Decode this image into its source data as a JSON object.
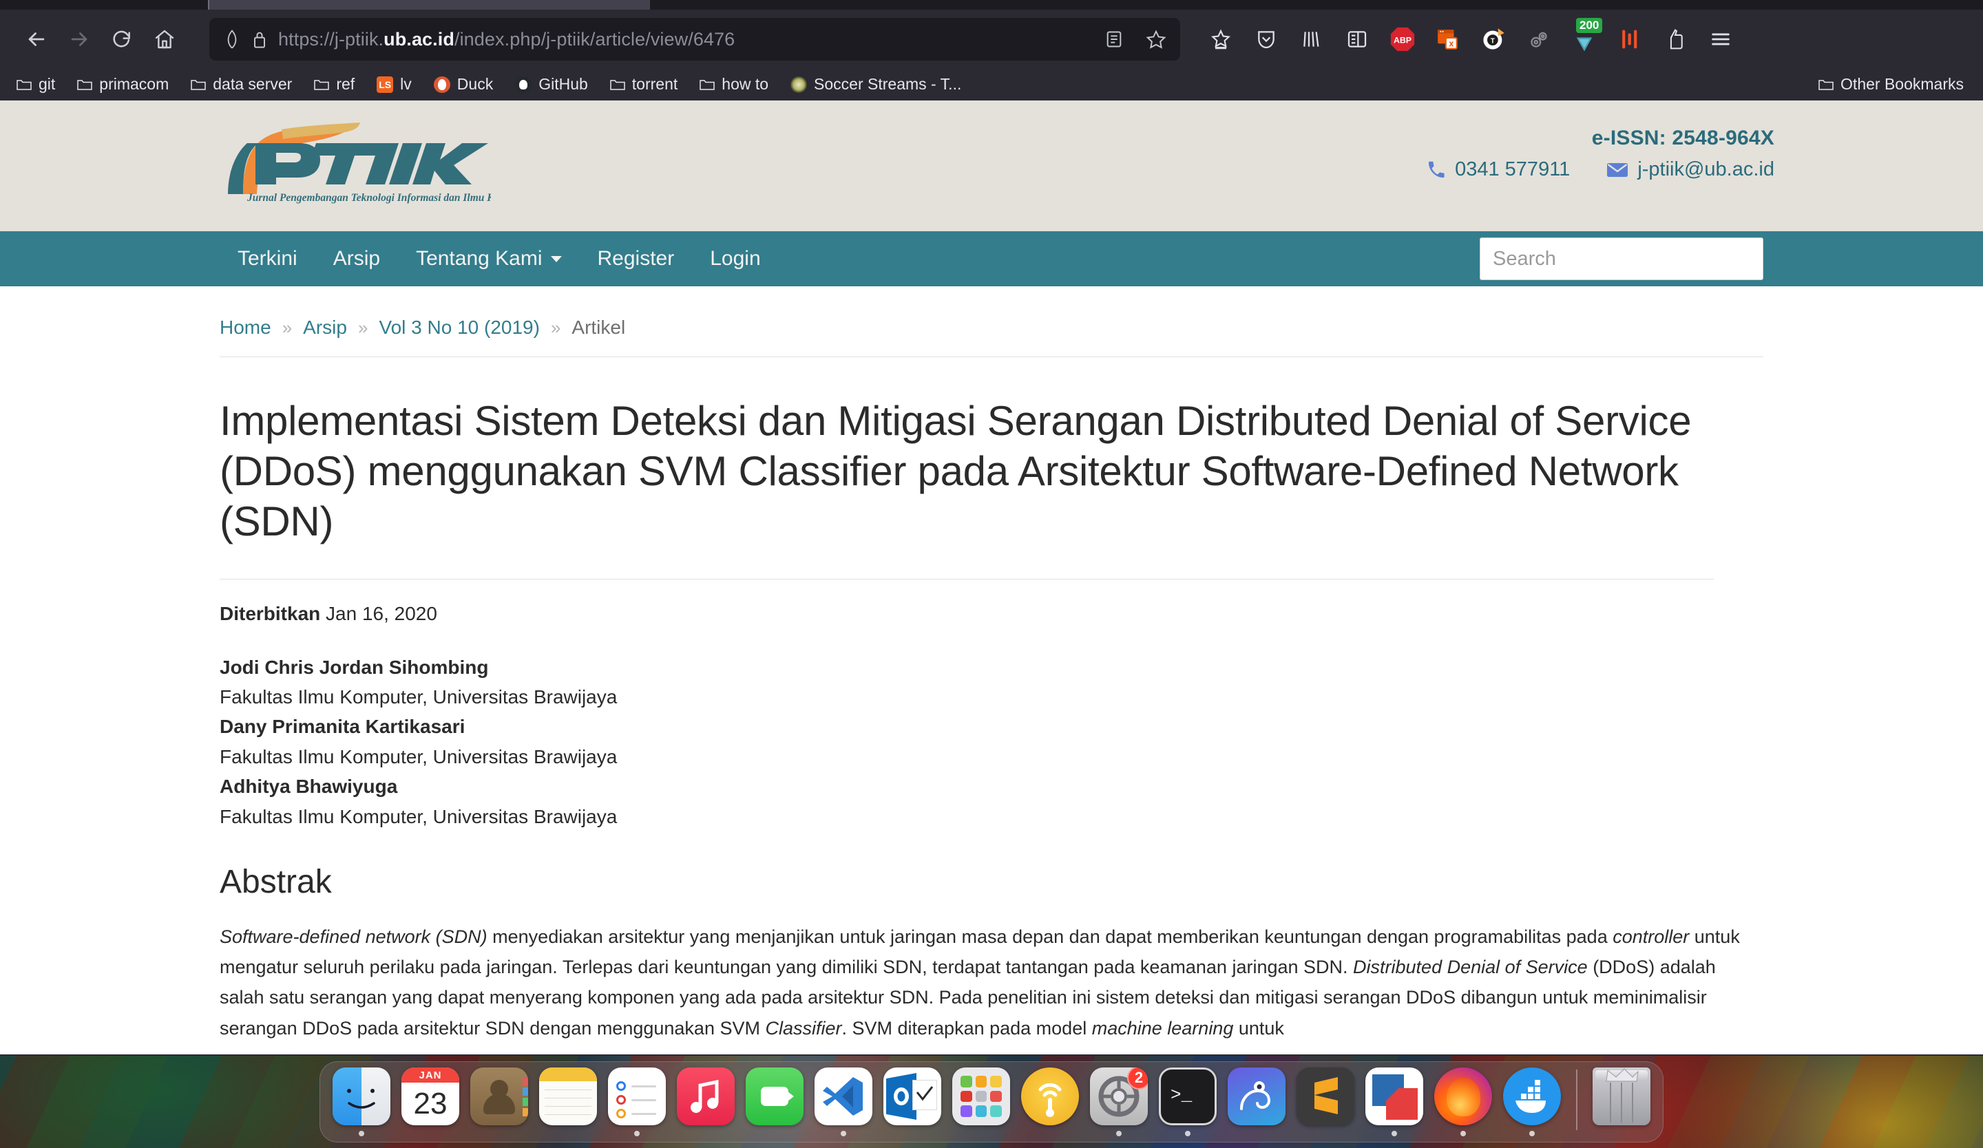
{
  "browser": {
    "url_prefix": "https://j-ptiik.",
    "url_domain": "ub.ac.id",
    "url_suffix": "/index.php/j-ptiik/article/view/6476",
    "toolbar_icons": [
      {
        "name": "back-button",
        "glyph": "←"
      },
      {
        "name": "forward-button",
        "glyph": "→"
      },
      {
        "name": "reload-button",
        "glyph": "⟳"
      },
      {
        "name": "home-button",
        "glyph": "⌂"
      }
    ],
    "extension_badge": "200",
    "extension_labels": [
      "bookmark-star",
      "pocket",
      "library",
      "reader-view",
      "adblock-plus",
      "popup-blocker",
      "tampermonkey",
      "cogs-extension",
      "umatrix",
      "redirector",
      "cookie-autodelete",
      "app-menu"
    ],
    "bookmarks": [
      {
        "label": "git",
        "icon": "folder-icon"
      },
      {
        "label": "primacom",
        "icon": "folder-icon"
      },
      {
        "label": "data server",
        "icon": "folder-icon"
      },
      {
        "label": "ref",
        "icon": "folder-icon"
      },
      {
        "label": "lv",
        "icon": "ls-favicon"
      },
      {
        "label": "Duck",
        "icon": "duckduckgo-favicon"
      },
      {
        "label": "GitHub",
        "icon": "github-favicon"
      },
      {
        "label": "torrent",
        "icon": "folder-icon"
      },
      {
        "label": "how to",
        "icon": "folder-icon"
      },
      {
        "label": "Soccer Streams - T...",
        "icon": "soccer-favicon"
      }
    ],
    "other_bookmarks": "Other Bookmarks"
  },
  "site": {
    "logo_text": "JPTIIK",
    "logo_tagline": "Jurnal Pengembangan Teknologi Informasi dan Ilmu Komputer",
    "eissn": "e-ISSN: 2548-964X",
    "phone": "0341 577911",
    "email": "j-ptiik@ub.ac.id",
    "nav": [
      {
        "label": "Terkini",
        "has_caret": false
      },
      {
        "label": "Arsip",
        "has_caret": false
      },
      {
        "label": "Tentang Kami",
        "has_caret": true
      },
      {
        "label": "Register",
        "has_caret": false
      },
      {
        "label": "Login",
        "has_caret": false
      }
    ],
    "search_placeholder": "Search",
    "search_value": ""
  },
  "breadcrumb": {
    "items": [
      {
        "label": "Home",
        "link": true
      },
      {
        "label": "Arsip",
        "link": true
      },
      {
        "label": "Vol 3 No 10 (2019)",
        "link": true
      },
      {
        "label": "Artikel",
        "link": false
      }
    ],
    "separator": "»"
  },
  "article": {
    "title": "Implementasi Sistem Deteksi dan Mitigasi Serangan Distributed Denial of Service (DDoS) menggunakan SVM Classifier pada Arsitektur Software-Defined Network (SDN)",
    "published_label": "Diterbitkan",
    "published_date": "Jan 16, 2020",
    "authors": [
      {
        "name": "Jodi Chris Jordan Sihombing",
        "affiliation": "Fakultas Ilmu Komputer, Universitas Brawijaya"
      },
      {
        "name": "Dany Primanita Kartikasari",
        "affiliation": "Fakultas Ilmu Komputer, Universitas Brawijaya"
      },
      {
        "name": "Adhitya Bhawiyuga",
        "affiliation": "Fakultas Ilmu Komputer, Universitas Brawijaya"
      }
    ],
    "abstract_heading": "Abstrak",
    "abstract_parts": [
      {
        "text": "Software-defined network (SDN)",
        "italic": true
      },
      {
        "text": " menyediakan arsitektur yang menjanjikan untuk jaringan masa depan dan dapat memberikan keuntungan dengan programabilitas pada ",
        "italic": false
      },
      {
        "text": "controller",
        "italic": true
      },
      {
        "text": " untuk mengatur seluruh perilaku pada jaringan. Terlepas dari keuntungan yang dimiliki SDN, terdapat tantangan pada keamanan jaringan SDN. ",
        "italic": false
      },
      {
        "text": "Distributed Denial of Service",
        "italic": true
      },
      {
        "text": " (DDoS) adalah salah satu serangan yang dapat menyerang komponen yang ada pada arsitektur SDN. Pada penelitian ini sistem deteksi dan mitigasi serangan DDoS dibangun untuk meminimalisir serangan DDoS pada arsitektur SDN dengan menggunakan SVM ",
        "italic": false
      },
      {
        "text": "Classifier",
        "italic": true
      },
      {
        "text": ". SVM diterapkan pada model ",
        "italic": false
      },
      {
        "text": "machine learning",
        "italic": true
      },
      {
        "text": " untuk",
        "italic": false
      }
    ]
  },
  "dock": {
    "items": [
      {
        "name": "finder",
        "label": "Finder",
        "running": true
      },
      {
        "name": "calendar",
        "label": "Calendar",
        "month": "JAN",
        "day": "23",
        "running": false
      },
      {
        "name": "contacts",
        "label": "Contacts",
        "running": false
      },
      {
        "name": "notes",
        "label": "Notes",
        "running": false
      },
      {
        "name": "reminders",
        "label": "Reminders",
        "running": true
      },
      {
        "name": "music",
        "label": "Music",
        "running": false
      },
      {
        "name": "facetime",
        "label": "FaceTime",
        "running": false
      },
      {
        "name": "vscode",
        "label": "Visual Studio Code",
        "running": true
      },
      {
        "name": "outlook",
        "label": "Outlook",
        "running": false
      },
      {
        "name": "launchpad",
        "label": "Launchpad",
        "running": false
      },
      {
        "name": "airport-utility",
        "label": "AirPort Utility",
        "running": false
      },
      {
        "name": "system-preferences",
        "label": "System Preferences",
        "badge": "2",
        "running": true
      },
      {
        "name": "terminal",
        "label": "Terminal",
        "running": true
      },
      {
        "name": "postman",
        "label": "Postman",
        "running": false
      },
      {
        "name": "sublime-text",
        "label": "Sublime Text",
        "running": false
      },
      {
        "name": "vmware-fusion",
        "label": "VMware Fusion",
        "running": true
      },
      {
        "name": "firefox",
        "label": "Firefox",
        "running": true
      },
      {
        "name": "docker",
        "label": "Docker",
        "running": false
      },
      {
        "name": "trash",
        "label": "Trash",
        "running": false
      }
    ]
  },
  "colors": {
    "site_teal": "#337d8c",
    "masthead_bg": "#e4e1da",
    "logo_orange": "#ef8c3c",
    "logo_teal": "#336e7b",
    "link_blue": "#337d8c",
    "contact_icon_blue": "#5b7fd4",
    "browser_chrome": "#2b2a33",
    "badge_green": "#28a745"
  }
}
